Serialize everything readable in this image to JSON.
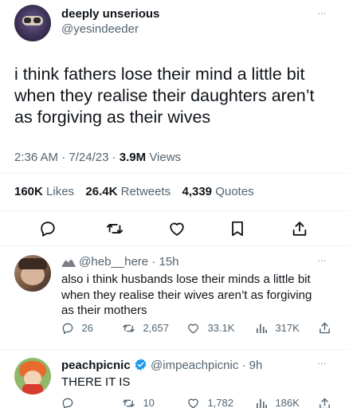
{
  "main_tweet": {
    "display_name": "deeply unserious",
    "handle": "@yesindeeder",
    "text_lines": [
      "i think fathers lose their mind a little bit",
      "when they realise their daughters aren’t",
      "as forgiving as their wives"
    ],
    "time": "2:36 AM",
    "date": "7/24/23",
    "separator": "·",
    "views_count": "3.9M",
    "views_label": "Views",
    "stats": {
      "likes_count": "160K",
      "likes_label": "Likes",
      "retweets_count": "26.4K",
      "retweets_label": "Retweets",
      "quotes_count": "4,339",
      "quotes_label": "Quotes"
    }
  },
  "replies": [
    {
      "name_icon": "mountain-emoji-icon",
      "handle": "@heb__here",
      "time": "· 15h",
      "text_lines": [
        "also i think husbands lose their minds a little bit",
        "when they realise their wives aren’t as forgiving",
        "as their mothers"
      ],
      "replies_count": "26",
      "retweets_count": "2,657",
      "likes_count": "33.1K",
      "views_count": "317K"
    },
    {
      "display_name": "peachpicnic",
      "verified": true,
      "handle": "@impeachpicnic",
      "time": "· 9h",
      "text_lines": [
        "THERE IT IS"
      ],
      "retweets_count": "10",
      "likes_count": "1,782",
      "views_count": "186K"
    }
  ],
  "more_icon": "···",
  "colors": {
    "text": "#0f1419",
    "muted": "#536471",
    "verified": "#1d9bf0",
    "divider": "#eff3f4"
  }
}
